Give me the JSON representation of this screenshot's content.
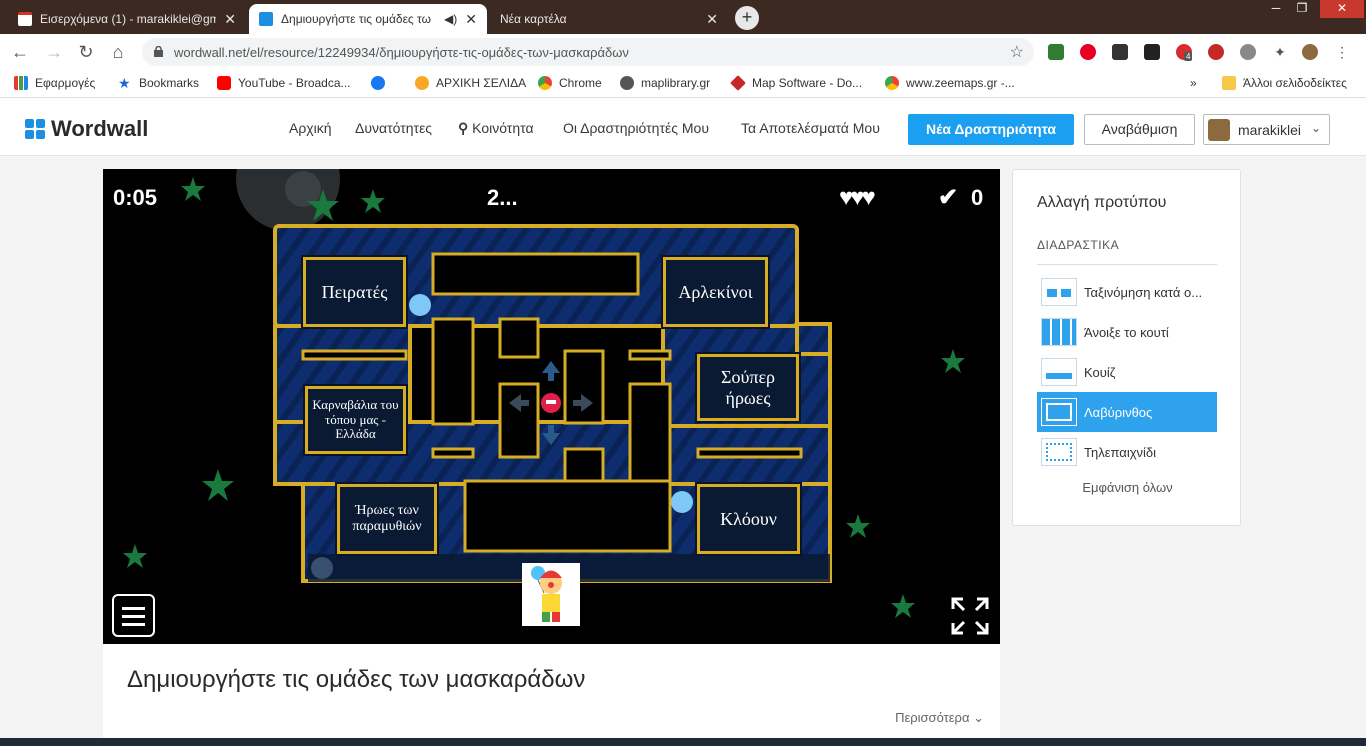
{
  "browser": {
    "tabs": [
      {
        "title": "Εισερχόμενα (1) - marakiklei@gm",
        "active": false
      },
      {
        "title": "Δημιουργήστε τις ομάδες τω",
        "active": true
      },
      {
        "title": "Νέα καρτέλα",
        "active": false
      }
    ],
    "url": "wordwall.net/el/resource/12249934/δημιουργήστε-τις-ομάδες-των-μασκαράδων",
    "extension_badge": "4",
    "bookmarks": [
      "Εφαρμογές",
      "Bookmarks",
      "YouTube - Broadca...",
      "ΑΡΧΙΚΗ ΣΕΛΙΔΑ",
      "Chrome",
      "maplibrary.gr",
      "Map Software - Do...",
      "www.zeemaps.gr -...",
      "Άλλοι σελιδοδείκτες"
    ]
  },
  "site": {
    "logo": "Wordwall",
    "nav": [
      "Αρχική",
      "Δυνατότητες",
      "Κοινότητα",
      "Οι Δραστηριότητές Μου",
      "Τα Αποτελέσματά Μου"
    ],
    "new_activity": "Νέα Δραστηριότητα",
    "upgrade": "Αναβάθμιση",
    "username": "marakiklei",
    "accent": "#1b9ff0"
  },
  "game": {
    "timer": "0:05",
    "question": "2...",
    "lives": 3,
    "score": "0",
    "answers": [
      "Πειρατές",
      "Αρλεκίνοι",
      "Σούπερ ήρωες",
      "Καρναβάλια του τόπου μας - Ελλάδα",
      "Ήρωες των παραμυθιών",
      "Κλόουν"
    ],
    "wall_color": "#d6ad24",
    "floor_color": "#0e2d6e"
  },
  "sidebar": {
    "title": "Αλλαγή προτύπου",
    "section": "ΔΙΑΔΡΑΣΤΙΚΑ",
    "templates": [
      {
        "label": "Ταξινόμηση κατά ο...",
        "selected": false
      },
      {
        "label": "Άνοιξε το κουτί",
        "selected": false
      },
      {
        "label": "Κουίζ",
        "selected": false
      },
      {
        "label": "Λαβύρινθος",
        "selected": true
      },
      {
        "label": "Τηλεπαιχνίδι",
        "selected": false
      }
    ],
    "show_all": "Εμφάνιση όλων"
  },
  "activity": {
    "title": "Δημιουργήστε τις ομάδες των μασκαράδων",
    "more": "Περισσότερα"
  }
}
